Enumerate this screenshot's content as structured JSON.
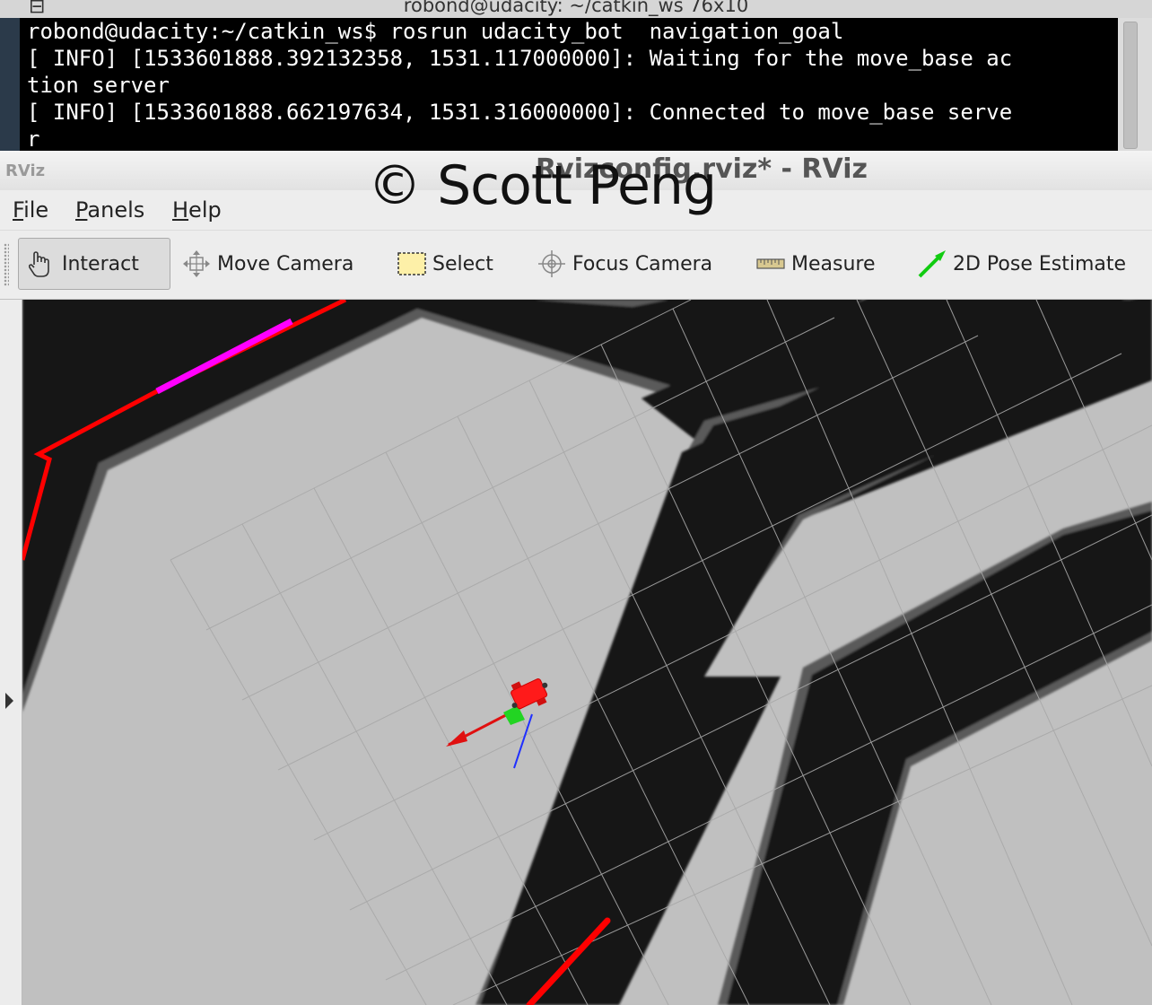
{
  "terminal": {
    "title": "robond@udacity: ~/catkin_ws 76x10",
    "lines": [
      "robond@udacity:~/catkin_ws$ rosrun udacity_bot  navigation_goal",
      "[ INFO] [1533601888.392132358, 1531.117000000]: Waiting for the move_base ac",
      "tion server",
      "[ INFO] [1533601888.662197634, 1531.316000000]: Connected to move_base serve",
      "r"
    ]
  },
  "rviz": {
    "logo": "RViz",
    "title": "Rvizconfig.rviz* - RViz",
    "watermark": "© Scott Peng",
    "menu": [
      {
        "label": "File",
        "u": "F",
        "rest": "ile"
      },
      {
        "label": "Panels",
        "u": "P",
        "rest": "anels"
      },
      {
        "label": "Help",
        "u": "H",
        "rest": "elp"
      }
    ],
    "tools": {
      "interact": "Interact",
      "move_camera": "Move Camera",
      "select": "Select",
      "focus_camera": "Focus Camera",
      "measure": "Measure",
      "pose_estimate": "2D Pose Estimate"
    },
    "colors": {
      "map_free": "#c0c0c0",
      "map_obstacle": "#161616",
      "global_plan": "#ff0000",
      "local_plan": "#ff00ff",
      "robot": "#ff1a1a",
      "grid": "#a8a8a8"
    }
  }
}
